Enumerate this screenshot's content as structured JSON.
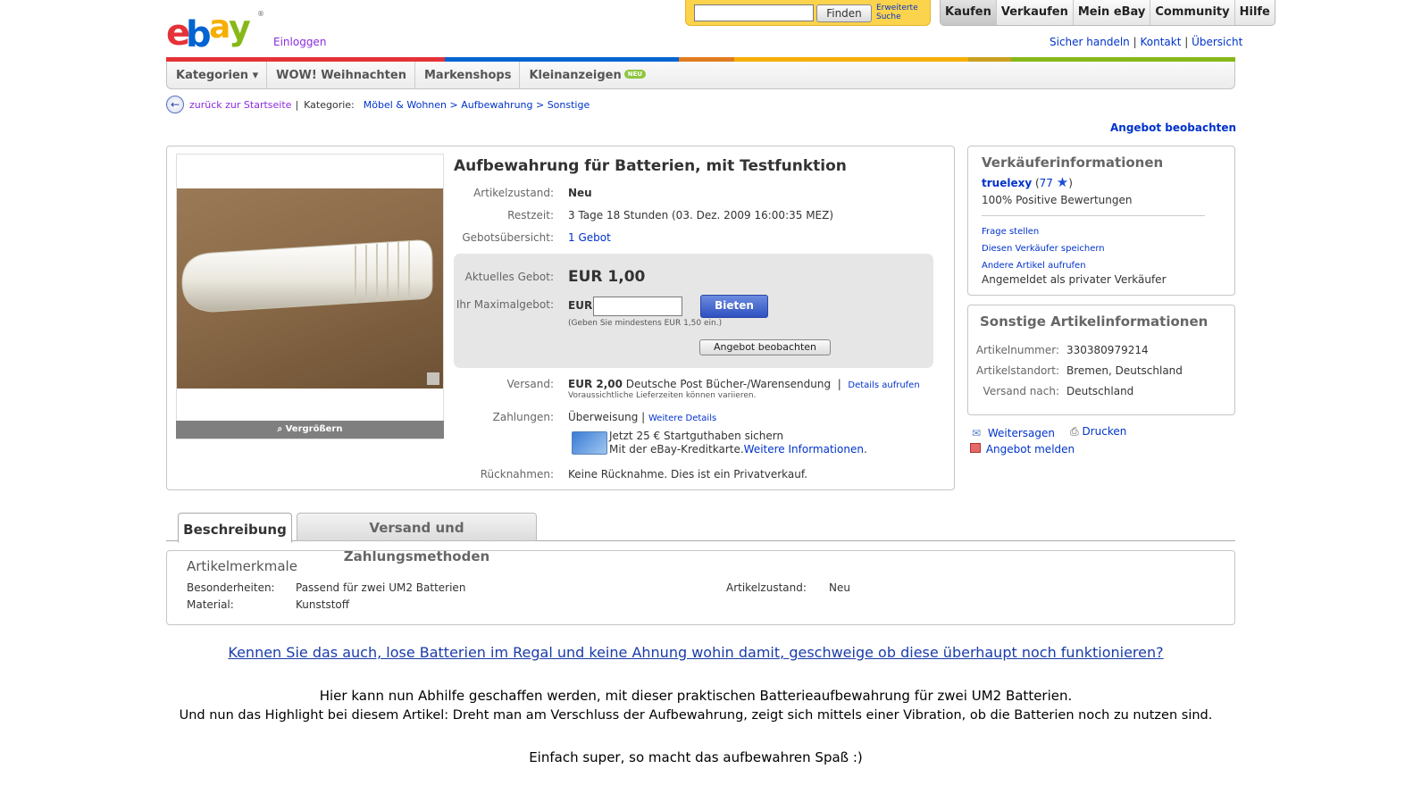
{
  "header": {
    "logo_text": "ebay",
    "login_label": "Einloggen",
    "search": {
      "placeholder": "",
      "value": "",
      "button_label": "Finden",
      "advanced_link": "Erweiterte Suche"
    },
    "top_nav": [
      "Kaufen",
      "Verkaufen",
      "Mein eBay",
      "Community",
      "Hilfe"
    ],
    "top_links": [
      "Sicher handeln",
      "Kontakt",
      "Übersicht"
    ],
    "colors": {
      "red": "#e53238",
      "blue": "#0064d2",
      "yellow": "#f5af02",
      "green": "#86b817"
    }
  },
  "cat_nav": [
    {
      "label": "Kategorien ▾"
    },
    {
      "label": "WOW! Weihnachten"
    },
    {
      "label": "Markenshops"
    },
    {
      "label": "Kleinanzeigen",
      "badge": "NEU"
    }
  ],
  "breadcrumb": {
    "back_label": "zurück zur Startseite",
    "category_label": "Kategorie:",
    "path": "Möbel & Wohnen > Aufbewahrung > Sonstige"
  },
  "watch_top_label": "Angebot beobachten",
  "item": {
    "title": "Aufbewahrung für Batterien, mit Testfunktion",
    "enlarge_label": "Vergrößern",
    "condition_label": "Artikelzustand:",
    "condition": "Neu",
    "time_left_label": "Restzeit:",
    "time_left": "3 Tage 18 Stunden (03. Dez. 2009 16:00:35 MEZ)",
    "bids_label": "Gebotsübersicht:",
    "bids": "1 Gebot",
    "current_bid_label": "Aktuelles Gebot:",
    "current_bid": "EUR 1,00",
    "max_bid_label": "Ihr Maximalgebot:",
    "currency": "EUR",
    "bid_button": "Bieten",
    "min_bid_note": "(Geben Sie mindestens EUR 1,50 ein.)",
    "watch_button": "Angebot beobachten",
    "shipping_label": "Versand:",
    "shipping_price": "EUR 2,00",
    "shipping_method": "Deutsche Post Bücher-/Warensendung",
    "shipping_details_link": "Details aufrufen",
    "shipping_note": "Voraussichtliche Lieferzeiten können variieren.",
    "payment_label": "Zahlungen:",
    "payment": "Überweisung",
    "payment_link": "Weitere Details",
    "promo_line1": "Jetzt 25 € Startguthaben sichern",
    "promo_line2": "Mit der eBay-Kreditkarte.",
    "promo_link": "Weitere Informationen",
    "returns_label": "Rücknahmen:",
    "returns": "Keine Rücknahme. Dies ist ein Privatverkauf."
  },
  "seller": {
    "title": "Verkäuferinformationen",
    "name": "truelexy",
    "feedback_score": "77",
    "positive": "100% Positive Bewertungen",
    "links": [
      "Frage stellen",
      "Diesen Verkäufer speichern",
      "Andere Artikel aufrufen"
    ],
    "note": "Angemeldet als privater Verkäufer"
  },
  "other_info": {
    "title": "Sonstige Artikelinformationen",
    "rows": [
      {
        "label": "Artikelnummer:",
        "value": "330380979214"
      },
      {
        "label": "Artikelstandort:",
        "value": "Bremen, Deutschland"
      },
      {
        "label": "Versand nach:",
        "value": "Deutschland"
      }
    ]
  },
  "actions": {
    "share": "Weitersagen",
    "print": "Drucken",
    "report": "Angebot melden"
  },
  "tabs": [
    "Beschreibung",
    "Versand und Zahlungsmethoden"
  ],
  "attributes": {
    "title": "Artikelmerkmale",
    "rows": [
      {
        "label": "Besonderheiten:",
        "value": "Passend für zwei UM2 Batterien"
      },
      {
        "label": "Material:",
        "value": "Kunststoff"
      }
    ],
    "right": {
      "label": "Artikelzustand:",
      "value": "Neu"
    }
  },
  "description": {
    "headline": "Kennen Sie das auch, lose Batterien im Regal und keine Ahnung wohin damit, geschweige ob diese überhaupt noch funktionieren?",
    "line1": "Hier kann nun Abhilfe geschaffen werden, mit dieser praktischen Batterieaufbewahrung für zwei UM2 Batterien.",
    "line2": "Und nun das Highlight bei diesem Artikel: Dreht man am Verschluss der Aufbewahrung, zeigt sich mittels einer Vibration, ob die Batterien noch zu nutzen sind.",
    "line3": "Einfach super, so macht das aufbewahren Spaß :)"
  }
}
